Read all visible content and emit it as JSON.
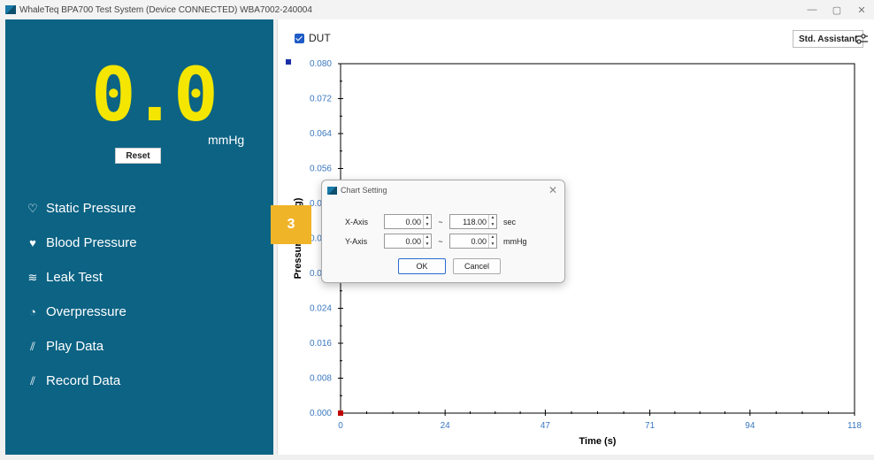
{
  "window": {
    "title": "WhaleTeq BPA700 Test System (Device CONNECTED)   WBA7002-240004",
    "minimize": "—",
    "restore": "▢",
    "close": "✕"
  },
  "readout": {
    "value": "0.0",
    "unit": "mmHg",
    "reset_label": "Reset"
  },
  "menu": [
    {
      "icon": "static-pressure-icon",
      "glyph": "♡",
      "label": "Static Pressure"
    },
    {
      "icon": "blood-pressure-icon",
      "glyph": "♥",
      "label": "Blood Pressure"
    },
    {
      "icon": "leak-test-icon",
      "glyph": "≋",
      "label": "Leak Test"
    },
    {
      "icon": "overpressure-icon",
      "glyph": "◔",
      "label": "Overpressure"
    },
    {
      "icon": "play-data-icon",
      "glyph": "⫽",
      "label": "Play Data"
    },
    {
      "icon": "record-data-icon",
      "glyph": "⫽",
      "label": "Record Data"
    }
  ],
  "chart_header": {
    "dut_label": "DUT",
    "std_assistant_label": "Std. Assistant"
  },
  "chart_data": {
    "type": "line",
    "series": [],
    "xlabel": "Time (s)",
    "ylabel": "Pressure (mmHg)",
    "xlim": [
      0,
      118
    ],
    "ylim": [
      0,
      0.08
    ],
    "x_ticks": [
      "0",
      "24",
      "47",
      "71",
      "94",
      "118"
    ],
    "y_ticks": [
      "0.000",
      "0.008",
      "0.016",
      "0.024",
      "0.032",
      "0.040",
      "0.048",
      "0.056",
      "0.064",
      "0.072",
      "0.080"
    ],
    "tick_color": "#3a78c0"
  },
  "badge": {
    "number": "3",
    "color": "#f0b429"
  },
  "dialog": {
    "title": "Chart Setting",
    "close": "✕",
    "x_axis": {
      "label": "X-Axis",
      "from": "0.00",
      "to": "118.00",
      "unit": "sec"
    },
    "y_axis": {
      "label": "Y-Axis",
      "from": "0.00",
      "to": "0.00",
      "unit": "mmHg"
    },
    "ok_label": "OK",
    "cancel_label": "Cancel"
  }
}
